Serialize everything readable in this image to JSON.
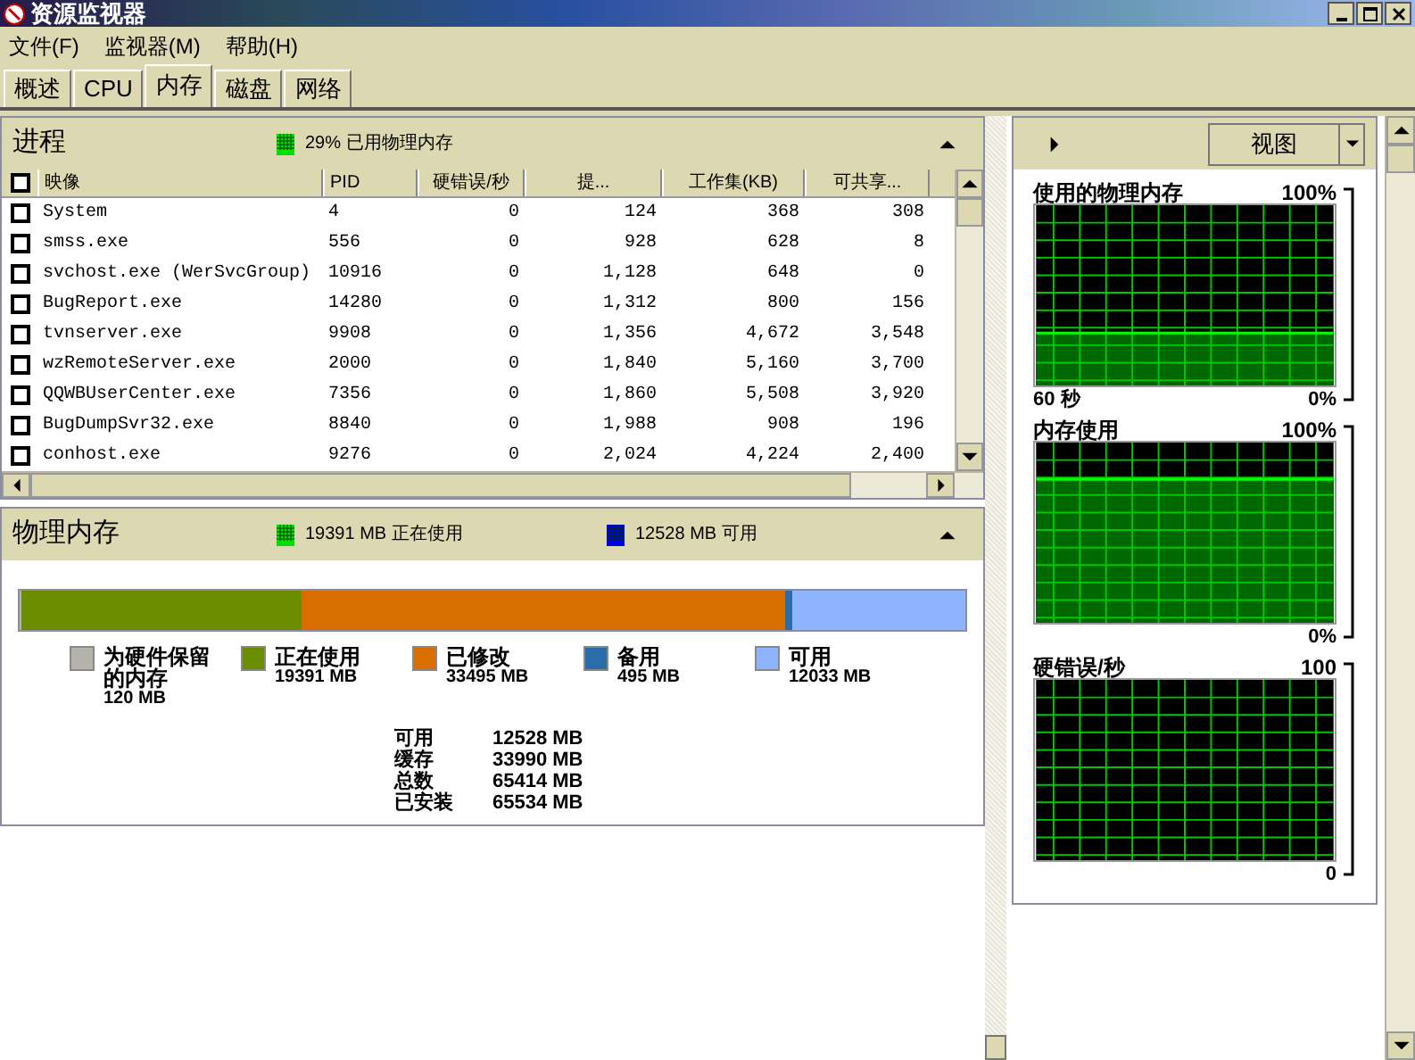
{
  "window": {
    "title": "资源监视器"
  },
  "menu": [
    "文件(F)",
    "监视器(M)",
    "帮助(H)"
  ],
  "tabs": [
    {
      "label": "概述",
      "selected": false
    },
    {
      "label": "CPU",
      "selected": false
    },
    {
      "label": "内存",
      "selected": true
    },
    {
      "label": "磁盘",
      "selected": false
    },
    {
      "label": "网络",
      "selected": false
    }
  ],
  "processes": {
    "title": "进程",
    "legend": "29% 已用物理内存",
    "expanded": true,
    "select_all_checked": false,
    "columns": [
      "映像",
      "PID",
      "硬错误/秒",
      "提...",
      "工作集(KB)",
      "可共享..."
    ],
    "rows": [
      {
        "checked": false,
        "cells": [
          "System",
          "4",
          "0",
          "124",
          "368",
          "308"
        ]
      },
      {
        "checked": false,
        "cells": [
          "smss.exe",
          "556",
          "0",
          "928",
          "628",
          "8"
        ]
      },
      {
        "checked": false,
        "cells": [
          "svchost.exe (WerSvcGroup)",
          "10916",
          "0",
          "1,128",
          "648",
          "0"
        ]
      },
      {
        "checked": false,
        "cells": [
          "BugReport.exe",
          "14280",
          "0",
          "1,312",
          "800",
          "156"
        ]
      },
      {
        "checked": false,
        "cells": [
          "tvnserver.exe",
          "9908",
          "0",
          "1,356",
          "4,672",
          "3,548"
        ]
      },
      {
        "checked": false,
        "cells": [
          "wzRemoteServer.exe",
          "2000",
          "0",
          "1,840",
          "5,160",
          "3,700"
        ]
      },
      {
        "checked": false,
        "cells": [
          "QQWBUserCenter.exe",
          "7356",
          "0",
          "1,860",
          "5,508",
          "3,920"
        ]
      },
      {
        "checked": false,
        "cells": [
          "BugDumpSvr32.exe",
          "8840",
          "0",
          "1,988",
          "908",
          "196"
        ]
      },
      {
        "checked": false,
        "cells": [
          "conhost.exe",
          "9276",
          "0",
          "2,024",
          "4,224",
          "2,400"
        ]
      }
    ]
  },
  "physical_memory": {
    "title": "物理内存",
    "expanded": true,
    "header_legend": [
      {
        "label": "19391 MB 正在使用",
        "color": "#00e000"
      },
      {
        "label": "12528 MB 可用",
        "color": "#0000e0"
      }
    ],
    "segments": [
      {
        "label": "为硬件保留的内存",
        "value": "120 MB",
        "color": "#b4b4ac"
      },
      {
        "label": "正在使用",
        "value": "19391 MB",
        "color": "#6b8e00"
      },
      {
        "label": "已修改",
        "value": "33495 MB",
        "color": "#d86e00"
      },
      {
        "label": "备用",
        "value": "495 MB",
        "color": "#2a6ca8"
      },
      {
        "label": "可用",
        "value": "12033 MB",
        "color": "#8fb4ff"
      }
    ],
    "stats": [
      {
        "label": "可用",
        "value": "12528 MB"
      },
      {
        "label": "缓存",
        "value": "33990 MB"
      },
      {
        "label": "总数",
        "value": "65414 MB"
      },
      {
        "label": "已安装",
        "value": "65534 MB"
      }
    ]
  },
  "side": {
    "view_button": "视图",
    "graphs": [
      {
        "title": "使用的物理内存",
        "max": "100%",
        "time": "60 秒",
        "min": "0%"
      },
      {
        "title": "内存使用",
        "max": "100%",
        "min": "0%"
      },
      {
        "title": "硬错误/秒",
        "max": "100",
        "min": "0"
      }
    ]
  }
}
